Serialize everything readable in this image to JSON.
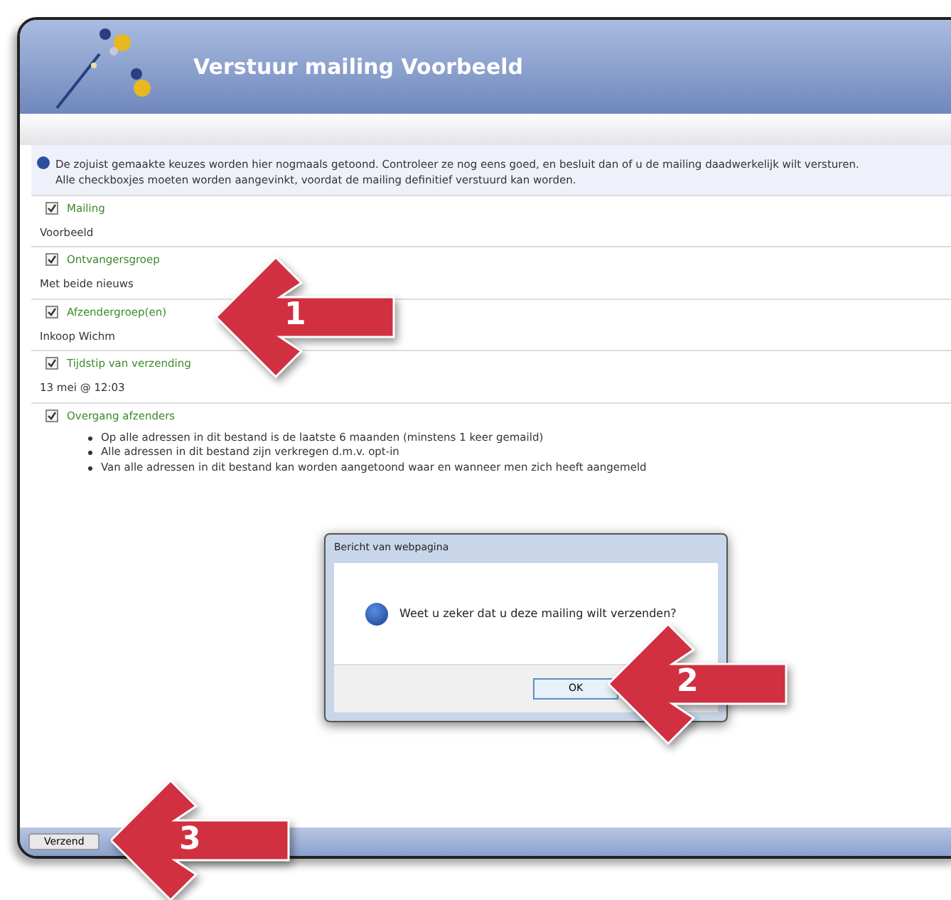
{
  "window": {
    "title": "Verstuur mailing Voorbeeld"
  },
  "info": [
    "De zojuist gemaakte keuzes worden hier nogmaals getoond. Controleer ze nog eens goed, en besluit dan of u de mailing daadwerkelijk wilt versturen.",
    "Alle checkboxjes moeten worden aangevinkt, voordat de mailing definitief verstuurd kan worden."
  ],
  "sections": [
    {
      "label": "Mailing",
      "checked": true,
      "kind": "text",
      "value": "Voorbeeld"
    },
    {
      "label": "Ontvangersgroep",
      "checked": true,
      "kind": "text",
      "value": "Met beide nieuws"
    },
    {
      "label": "Afzendergroep(en)",
      "checked": true,
      "kind": "text",
      "value": "Inkoop Wichm"
    },
    {
      "label": "Tijdstip van verzending",
      "checked": true,
      "kind": "text",
      "value": "13 mei @ 12:03"
    },
    {
      "label": "Overgang afzenders",
      "checked": true,
      "kind": "list",
      "items": [
        "Op alle adressen in dit bestand is de laatste 6 maanden (minstens 1 keer gemaild)",
        "Alle adressen in dit bestand zijn verkregen d.m.v. opt-in",
        "Van alle adressen in dit bestand kan worden aangetoond waar en wanneer men zich heeft aangemeld"
      ]
    }
  ],
  "dialog": {
    "title": "Bericht van webpagina",
    "message": "Weet u zeker dat u deze mailing wilt verzenden?",
    "ok": "OK"
  },
  "footer_button": "Verzend",
  "callouts": [
    "1",
    "2",
    "3"
  ]
}
